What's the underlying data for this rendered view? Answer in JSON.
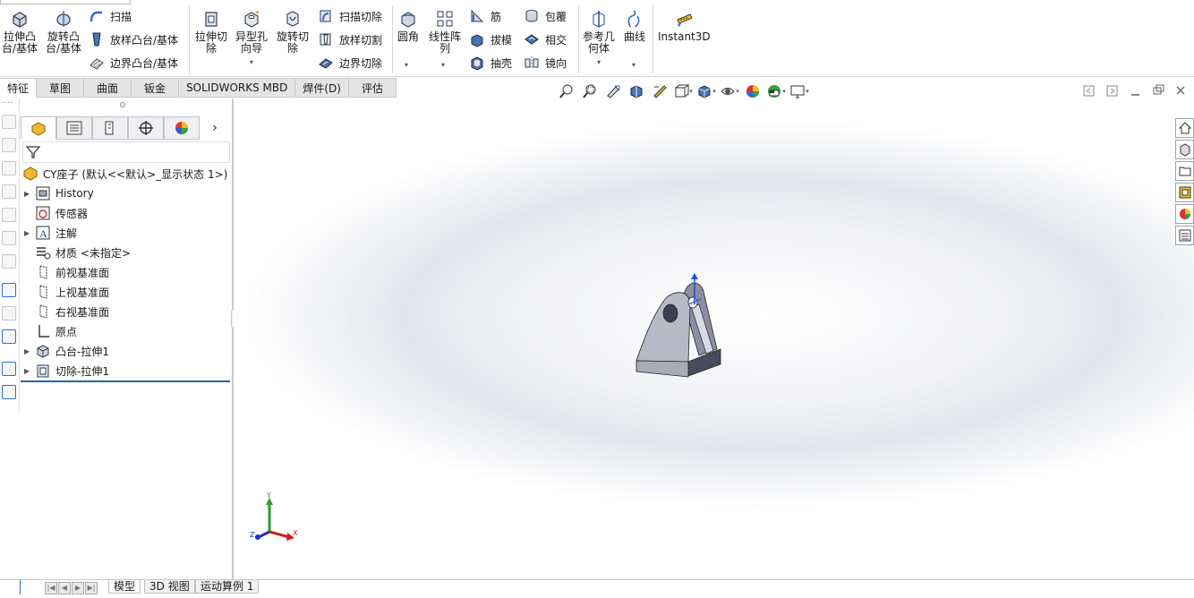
{
  "ribbon": {
    "extrude_boss": "拉伸凸\n台/基体",
    "revolve_boss": "旋转凸\n台/基体",
    "sweep": "扫描",
    "loft_boss": "放样凸台/基体",
    "boundary_boss": "边界凸台/基体",
    "extrude_cut": "拉伸切\n除",
    "hole_wizard": "异型孔\n向导",
    "revolve_cut": "旋转切\n除",
    "swept_cut": "扫描切除",
    "lofted_cut": "放样切割",
    "boundary_cut": "边界切除",
    "fillet": "圆角",
    "linear_pattern": "线性阵\n列",
    "rib": "筋",
    "draft": "拔模",
    "shell": "抽壳",
    "wrap": "包覆",
    "intersect": "相交",
    "mirror": "镜向",
    "ref_geometry": "参考几\n何体",
    "curves": "曲线",
    "instant3d": "Instant3D"
  },
  "tabs": [
    "特征",
    "草图",
    "曲面",
    "钣金",
    "SOLIDWORKS MBD",
    "焊件(D)",
    "评估"
  ],
  "tree": {
    "root": "CY座子 (默认<<默认>_显示状态 1>)",
    "items": [
      {
        "label": "History",
        "expandable": true,
        "icon": "history-icon"
      },
      {
        "label": "传感器",
        "expandable": false,
        "icon": "sensor-icon"
      },
      {
        "label": "注解",
        "expandable": true,
        "icon": "annotation-icon"
      },
      {
        "label": "材质 <未指定>",
        "expandable": false,
        "icon": "material-icon"
      },
      {
        "label": "前视基准面",
        "expandable": false,
        "icon": "plane-icon"
      },
      {
        "label": "上视基准面",
        "expandable": false,
        "icon": "plane-icon"
      },
      {
        "label": "右视基准面",
        "expandable": false,
        "icon": "plane-icon"
      },
      {
        "label": "原点",
        "expandable": false,
        "icon": "origin-icon"
      },
      {
        "label": "凸台-拉伸1",
        "expandable": true,
        "icon": "boss-extrude-icon"
      },
      {
        "label": "切除-拉伸1",
        "expandable": true,
        "icon": "cut-extrude-icon"
      }
    ]
  },
  "triad": {
    "x": "X",
    "y": "Y",
    "z": "Z"
  },
  "bottom_tabs": [
    "模型",
    "3D 视图",
    "运动算例 1"
  ],
  "colors": {
    "accent": "#2a5fb0",
    "part": "#b9bcc6",
    "part_dark": "#55556a"
  }
}
